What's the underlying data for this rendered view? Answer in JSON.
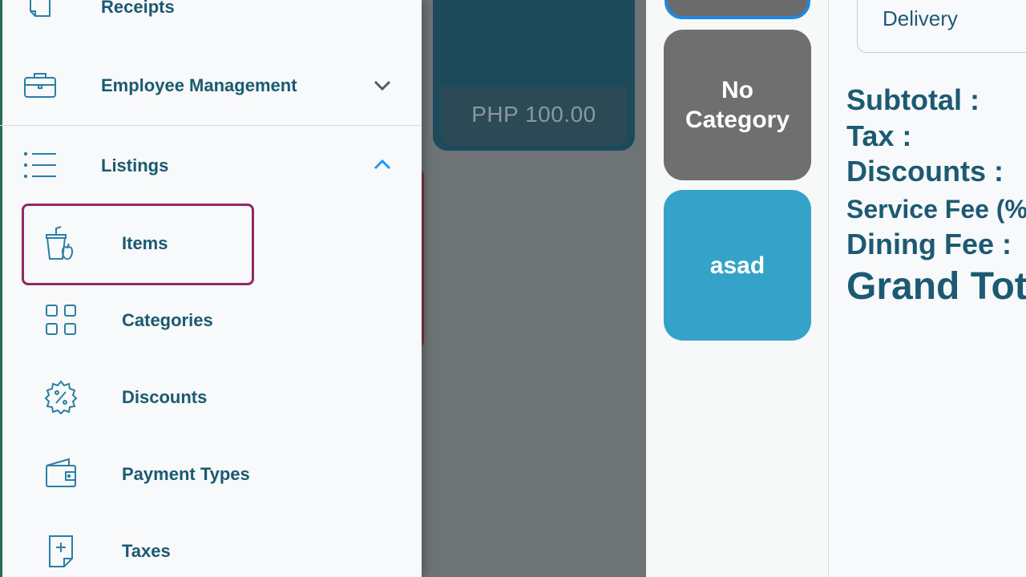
{
  "drawer": {
    "receipts_label": "Receipts",
    "employee_management_label": "Employee Management",
    "listings_label": "Listings",
    "listings_items": [
      {
        "label": "Items",
        "icon": "cup-apple-icon",
        "selected": true
      },
      {
        "label": "Categories",
        "icon": "grid-icon",
        "selected": false
      },
      {
        "label": "Discounts",
        "icon": "discount-badge-icon",
        "selected": false
      },
      {
        "label": "Payment Types",
        "icon": "wallet-icon",
        "selected": false
      },
      {
        "label": "Taxes",
        "icon": "tax-document-icon",
        "selected": false
      }
    ],
    "selected_color": "#8e2a63",
    "label_color": "#1a5a70",
    "icon_color": "#2a7fa5"
  },
  "products": {
    "price": "PHP 100.00"
  },
  "categories": [
    {
      "label": "No Category",
      "color": "#6f6f6f"
    },
    {
      "label": "asad",
      "color": "#35a3c9"
    }
  ],
  "summary": {
    "delivery_label": "Delivery",
    "subtotal_label": "Subtotal :",
    "tax_label": "Tax :",
    "discounts_label": "Discounts :",
    "service_fee_label": "Service Fee (%",
    "dining_fee_label": "Dining Fee :",
    "grand_total_label": "Grand Tot"
  }
}
